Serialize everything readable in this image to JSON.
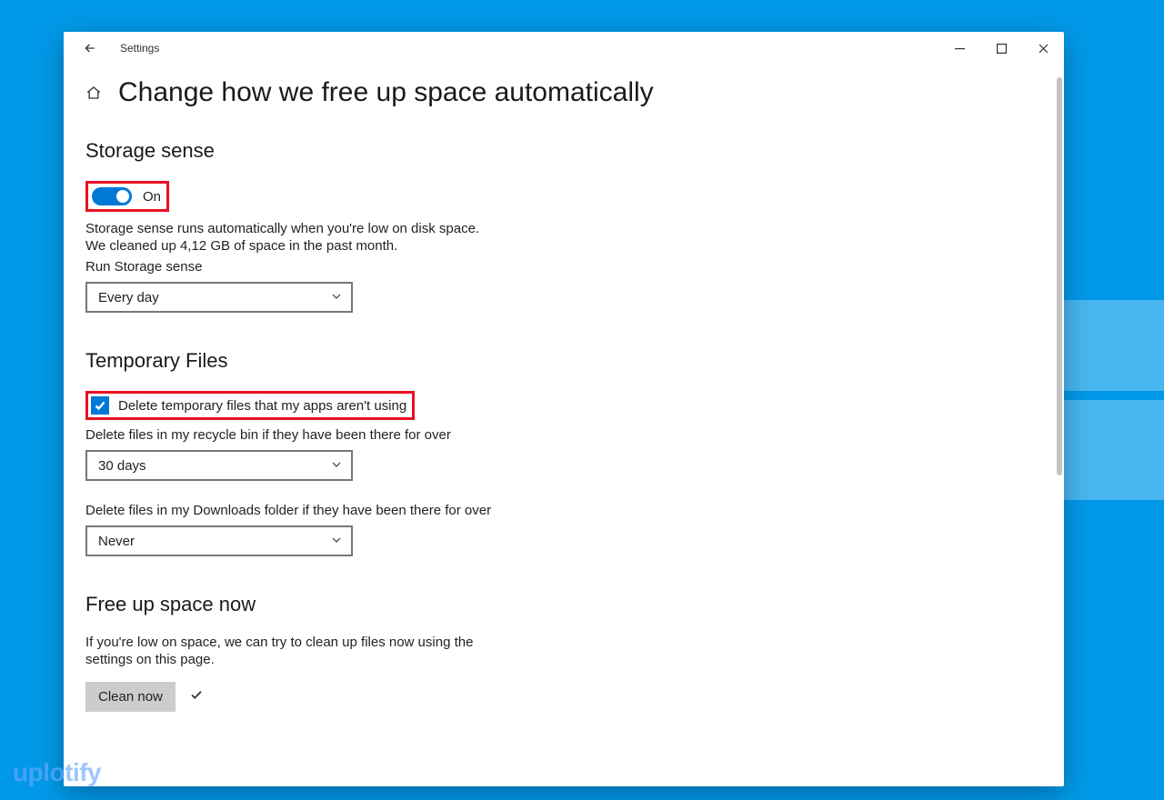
{
  "window": {
    "app_title": "Settings"
  },
  "header": {
    "page_title": "Change how we free up space automatically"
  },
  "storage_sense": {
    "section_title": "Storage sense",
    "toggle_state": "On",
    "desc_line1": "Storage sense runs automatically when you're low on disk space.",
    "desc_line2": "We cleaned up 4,12 GB of space in the past month.",
    "run_label": "Run Storage sense",
    "run_value": "Every day"
  },
  "temp_files": {
    "section_title": "Temporary Files",
    "checkbox_label": "Delete temporary files that my apps aren't using",
    "recycle_label": "Delete files in my recycle bin if they have been there for over",
    "recycle_value": "30 days",
    "downloads_label": "Delete files in my Downloads folder if they have been there for over",
    "downloads_value": "Never"
  },
  "free_up": {
    "section_title": "Free up space now",
    "desc_line1": "If you're low on space, we can try to clean up files now using the",
    "desc_line2": "settings on this page.",
    "button_label": "Clean now"
  },
  "watermark": "uplotify"
}
